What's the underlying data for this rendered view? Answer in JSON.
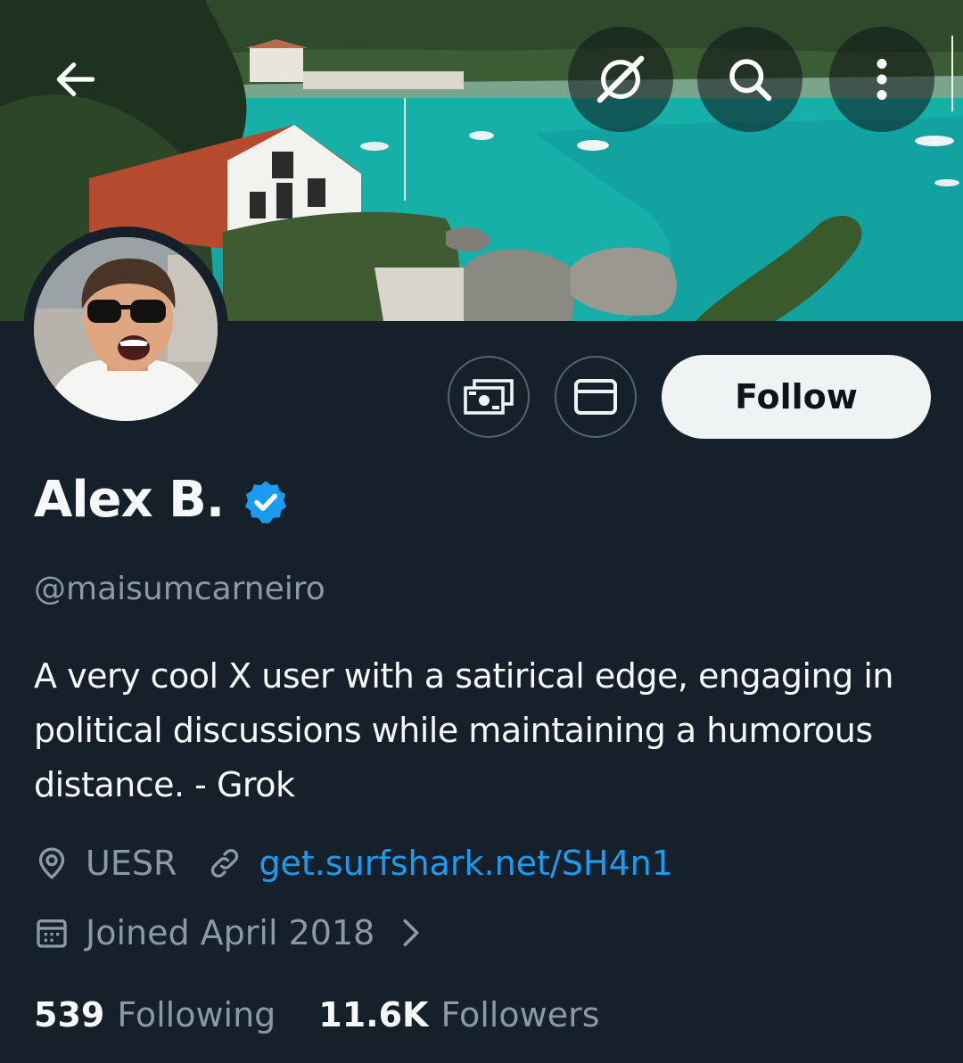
{
  "header": {
    "back_icon": "arrow-left-icon",
    "grok_icon": "grok-icon",
    "search_icon": "search-icon",
    "more_icon": "more-vertical-icon"
  },
  "profile": {
    "display_name": "Alex B.",
    "verified": true,
    "handle": "@maisumcarneiro",
    "bio": "A very cool X user with a satirical edge, engaging in political discussions while maintaining a humorous distance. - Grok",
    "location": "UESR",
    "website": "get.surfshark.net/SH4n1",
    "joined": "Joined April 2018"
  },
  "actions": {
    "subscribe_icon": "money-icon",
    "message_icon": "envelope-icon",
    "follow_label": "Follow"
  },
  "stats": {
    "following_count": "539",
    "following_label": "Following",
    "followers_count": "11.6K",
    "followers_label": "Followers"
  },
  "colors": {
    "background": "#15202b",
    "accent": "#1d9bf0",
    "secondary_text": "#8b98a5"
  }
}
